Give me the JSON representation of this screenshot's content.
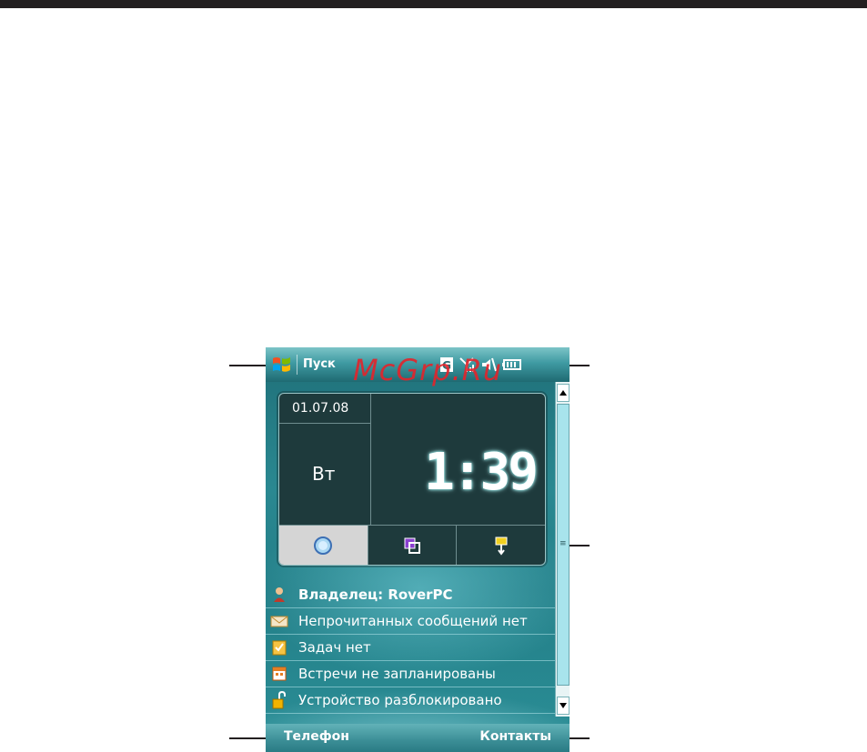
{
  "watermark": "McGrp.Ru",
  "titlebar": {
    "start_label": "Пуск",
    "status_icons": [
      "gprs-icon",
      "signal-icon",
      "speaker-icon",
      "battery-icon"
    ],
    "gprs_letter": "G"
  },
  "clock": {
    "date": "01.07.08",
    "day": "Вт",
    "time": "1:39",
    "tabs": [
      "clock-tab-icon",
      "windows-tab-icon",
      "settings-tab-icon"
    ]
  },
  "today": {
    "owner": "Владелец: RoverPC",
    "messages": "Непрочитанных сообщений нет",
    "tasks": "Задач нет",
    "appointments": "Встречи не запланированы",
    "device": "Устройство разблокировано"
  },
  "softkeys": {
    "left": "Телефон",
    "right": "Контакты"
  },
  "colors": {
    "accent": "#2a8891",
    "watermark": "#e3242b",
    "panel": "#1e3a3c"
  }
}
